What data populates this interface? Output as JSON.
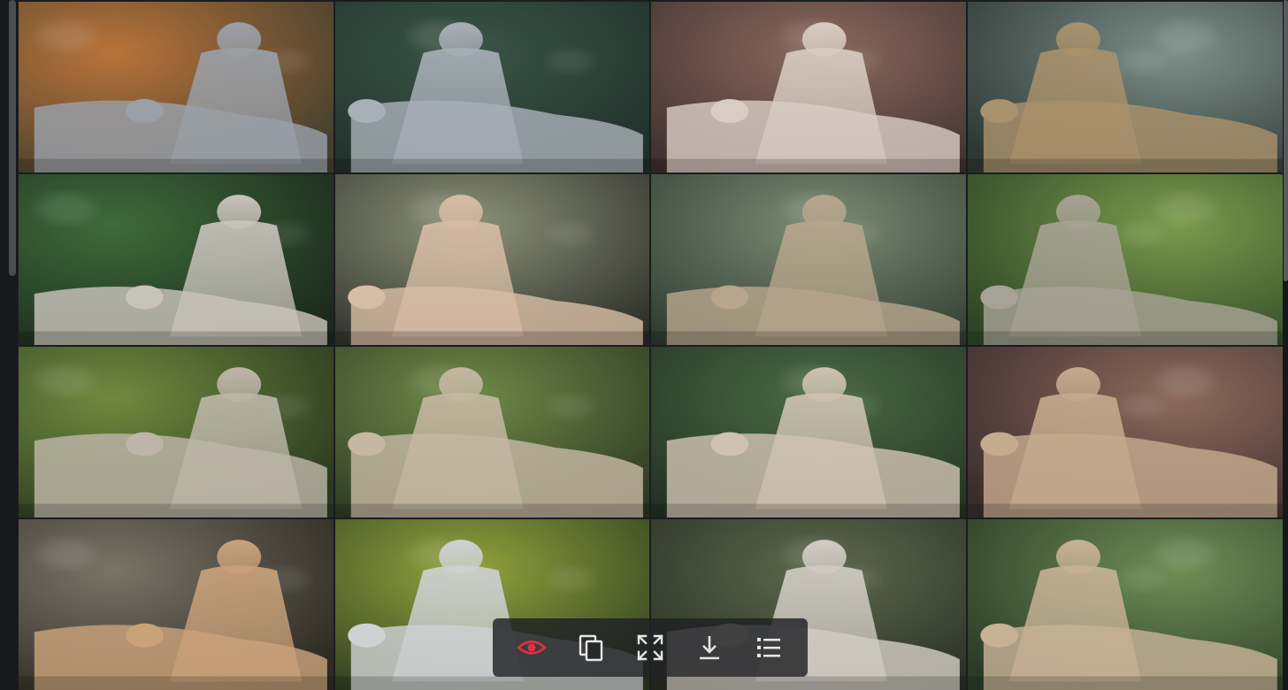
{
  "gallery": {
    "tiles": [
      {
        "row": 1,
        "col": 1,
        "palette": {
          "bg1": "#b9733a",
          "bg2": "#44402e",
          "fig": "#9aa0a8"
        }
      },
      {
        "row": 1,
        "col": 2,
        "palette": {
          "bg1": "#3a5546",
          "bg2": "#1f2e2a",
          "fig": "#a8afb6"
        }
      },
      {
        "row": 1,
        "col": 3,
        "palette": {
          "bg1": "#8a6a5e",
          "bg2": "#3c2e2c",
          "fig": "#d9ccc2"
        }
      },
      {
        "row": 1,
        "col": 4,
        "palette": {
          "bg1": "#7d8f8a",
          "bg2": "#2d3834",
          "fig": "#a9916b"
        }
      },
      {
        "row": 2,
        "col": 1,
        "palette": {
          "bg1": "#3e6b3a",
          "bg2": "#1c2a1d",
          "fig": "#c9c3bc"
        }
      },
      {
        "row": 2,
        "col": 2,
        "palette": {
          "bg1": "#8c9278",
          "bg2": "#2a2c26",
          "fig": "#d7bca4"
        }
      },
      {
        "row": 2,
        "col": 3,
        "palette": {
          "bg1": "#7b8c74",
          "bg2": "#2d3a2e",
          "fig": "#b7a58c"
        }
      },
      {
        "row": 2,
        "col": 4,
        "palette": {
          "bg1": "#7a9a4c",
          "bg2": "#2e4626",
          "fig": "#a7a295"
        }
      },
      {
        "row": 3,
        "col": 1,
        "palette": {
          "bg1": "#6f8a3e",
          "bg2": "#2a3a20",
          "fig": "#bdb6a8"
        }
      },
      {
        "row": 3,
        "col": 2,
        "palette": {
          "bg1": "#6f8a47",
          "bg2": "#2a3522",
          "fig": "#c6b7a3"
        }
      },
      {
        "row": 3,
        "col": 3,
        "palette": {
          "bg1": "#4b6a45",
          "bg2": "#213021",
          "fig": "#cfc2b2"
        }
      },
      {
        "row": 3,
        "col": 4,
        "palette": {
          "bg1": "#8c6a5c",
          "bg2": "#3a2d2c",
          "fig": "#c4ab8e"
        }
      },
      {
        "row": 4,
        "col": 1,
        "palette": {
          "bg1": "#7a7466",
          "bg2": "#2e2b24",
          "fig": "#c9a27a"
        }
      },
      {
        "row": 4,
        "col": 2,
        "palette": {
          "bg1": "#93a33c",
          "bg2": "#2a3a1f",
          "fig": "#cfd1d3"
        }
      },
      {
        "row": 4,
        "col": 3,
        "palette": {
          "bg1": "#5d6a4d",
          "bg2": "#262b22",
          "fig": "#d2ccc4"
        }
      },
      {
        "row": 4,
        "col": 4,
        "palette": {
          "bg1": "#6f8d56",
          "bg2": "#2a3c26",
          "fig": "#c7b296"
        }
      }
    ]
  },
  "toolbar": {
    "accent": "#e0303f",
    "icon_color": "#e6e6e6",
    "buttons": [
      {
        "icon": "eye-icon",
        "active": true
      },
      {
        "icon": "copy-icon"
      },
      {
        "icon": "fullscreen-icon"
      },
      {
        "icon": "download-icon"
      },
      {
        "icon": "list-icon"
      }
    ]
  }
}
